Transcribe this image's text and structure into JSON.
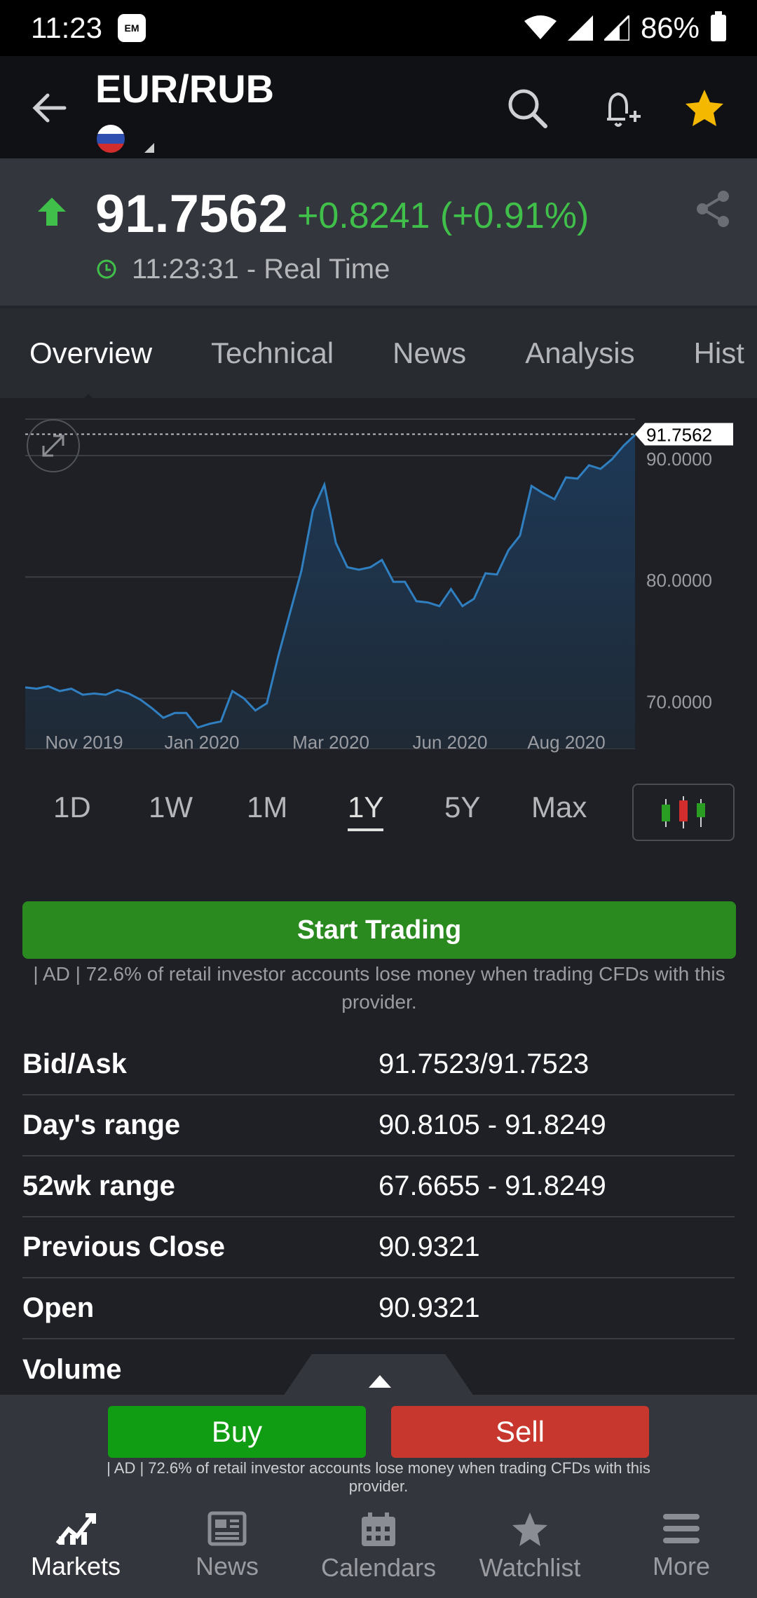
{
  "status_bar": {
    "time": "11:23",
    "notif_icon": "EM",
    "battery": "86%"
  },
  "header": {
    "title": "EUR/RUB",
    "flag": "russia-flag-icon"
  },
  "quote": {
    "price": "91.7562",
    "change": "+0.8241 (+0.91%)",
    "time": "11:23:31 - Real Time",
    "up_color": "#40c04a"
  },
  "tabs": [
    "Overview",
    "Technical",
    "News",
    "Analysis",
    "Hist"
  ],
  "chart_data": {
    "type": "area",
    "x_labels": [
      "Nov 2019",
      "Jan 2020",
      "Mar 2020",
      "Jun 2020",
      "Aug 2020"
    ],
    "y_ticks": [
      "70.0000",
      "80.0000",
      "90.0000"
    ],
    "ylim": [
      67.6,
      93.0
    ],
    "current_label": "91.7562",
    "current_value": 91.7562,
    "series_color": "#2f7fc1",
    "values": [
      70.9,
      70.8,
      71.0,
      70.6,
      70.8,
      70.3,
      70.4,
      70.3,
      70.7,
      70.4,
      69.9,
      69.2,
      68.4,
      68.8,
      68.8,
      67.6,
      67.9,
      68.1,
      70.6,
      70.0,
      69.0,
      69.6,
      73.5,
      77.0,
      80.5,
      85.5,
      87.6,
      82.8,
      80.8,
      80.6,
      80.8,
      81.4,
      79.6,
      79.6,
      78.0,
      77.9,
      77.6,
      79.0,
      77.6,
      78.2,
      80.3,
      80.2,
      82.2,
      83.4,
      87.5,
      86.9,
      86.4,
      88.2,
      88.1,
      89.2,
      88.9,
      89.7,
      90.8,
      91.7
    ]
  },
  "ranges": [
    "1D",
    "1W",
    "1M",
    "1Y",
    "5Y",
    "Max"
  ],
  "active_range": "1Y",
  "trade": {
    "label": "Start Trading",
    "disclaimer": "| AD | 72.6% of retail investor accounts lose money when trading CFDs with this provider."
  },
  "stats": [
    {
      "k": "Bid/Ask",
      "v": "91.7523/91.7523"
    },
    {
      "k": "Day's range",
      "v": "90.8105 - 91.8249"
    },
    {
      "k": "52wk range",
      "v": "67.6655 - 91.8249"
    },
    {
      "k": "Previous Close",
      "v": "90.9321"
    },
    {
      "k": "Open",
      "v": "90.9321"
    },
    {
      "k": "Volume",
      "v": ""
    }
  ],
  "actions": {
    "buy": "Buy",
    "sell": "Sell",
    "disclaimer": "| AD | 72.6% of retail investor accounts lose money when trading CFDs with this provider."
  },
  "bottom_nav": [
    {
      "label": "Markets",
      "icon": "markets-icon"
    },
    {
      "label": "News",
      "icon": "news-icon"
    },
    {
      "label": "Calendars",
      "icon": "calendar-icon"
    },
    {
      "label": "Watchlist",
      "icon": "star-icon"
    },
    {
      "label": "More",
      "icon": "menu-icon"
    }
  ]
}
